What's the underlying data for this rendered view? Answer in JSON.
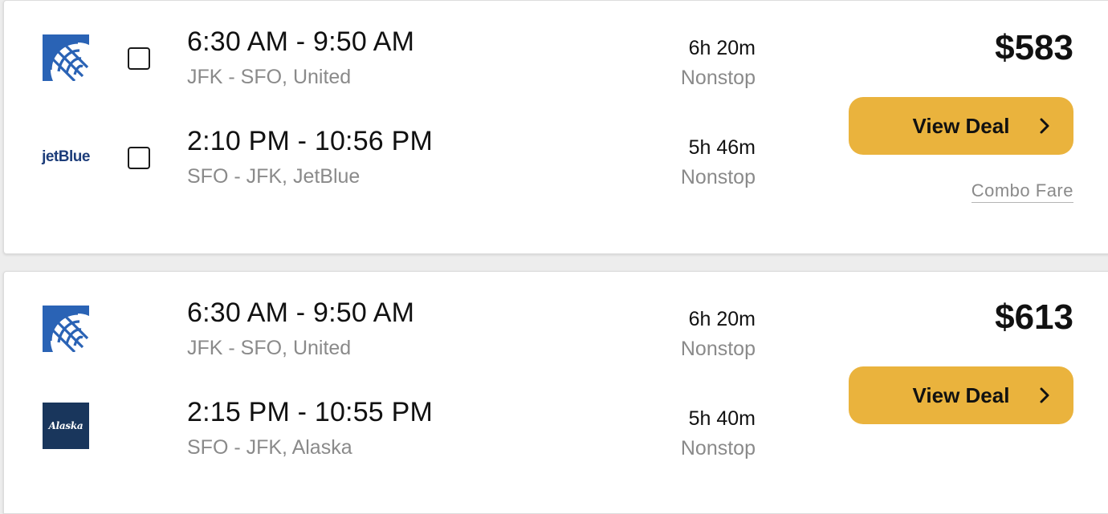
{
  "results": [
    {
      "price": "$583",
      "deal_label": "View Deal",
      "note": "Combo Fare",
      "legs": [
        {
          "airline_icon": "united-globe-icon",
          "times": "6:30 AM - 9:50 AM",
          "route": "JFK - SFO, United",
          "duration": "6h 20m",
          "stops": "Nonstop"
        },
        {
          "airline_icon": "jetblue-logo-icon",
          "logo_text": "jetBlue",
          "times": "2:10 PM - 10:56 PM",
          "route": "SFO - JFK, JetBlue",
          "duration": "5h 46m",
          "stops": "Nonstop"
        }
      ]
    },
    {
      "price": "$613",
      "deal_label": "View Deal",
      "legs": [
        {
          "airline_icon": "united-globe-icon",
          "times": "6:30 AM - 9:50 AM",
          "route": "JFK - SFO, United",
          "duration": "6h 20m",
          "stops": "Nonstop"
        },
        {
          "airline_icon": "alaska-logo-icon",
          "logo_text": "Alaska",
          "times": "2:15 PM - 10:55 PM",
          "route": "SFO - JFK, Alaska",
          "duration": "5h 40m",
          "stops": "Nonstop"
        }
      ]
    }
  ],
  "colors": {
    "button": "#eab33d",
    "united_blue": "#1f5fb3",
    "alaska_navy": "#19365c",
    "jetblue_navy": "#1d3d7a"
  }
}
